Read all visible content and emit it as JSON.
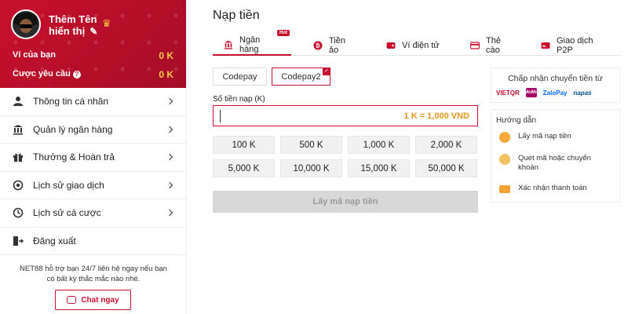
{
  "profile": {
    "name_line1": "Thêm Tên",
    "name_line2": "hiển thị",
    "wallet_label": "Ví của bạn",
    "wallet_value": "0 K",
    "bet_req_label": "Cược yêu cầu",
    "bet_req_value": "0 K"
  },
  "menu": [
    {
      "label": "Thông tin cá nhân",
      "icon": "user-icon"
    },
    {
      "label": "Quản lý ngân hàng",
      "icon": "bank-icon"
    },
    {
      "label": "Thưởng & Hoàn trả",
      "icon": "gift-icon"
    },
    {
      "label": "Lịch sử giao dịch",
      "icon": "history-icon"
    },
    {
      "label": "Lịch sử cá cược",
      "icon": "bet-history-icon"
    },
    {
      "label": "Đăng xuất",
      "icon": "logout-icon"
    }
  ],
  "support": {
    "text": "NET88 hỗ trợ bạn 24/7 liên hệ ngay nếu bạn có bất kỳ thắc mắc nào nhé.",
    "chat_label": "Chat ngay"
  },
  "page": {
    "title": "Nạp tiền"
  },
  "tabs": [
    {
      "label": "Ngân hàng",
      "badge": "Hot",
      "active": true
    },
    {
      "label": "Tiền ảo"
    },
    {
      "label": "Ví điện tử"
    },
    {
      "label": "Thẻ cào"
    },
    {
      "label": "Giao dịch P2P"
    }
  ],
  "subtabs": [
    {
      "label": "Codepay"
    },
    {
      "label": "Codepay2",
      "active": true
    }
  ],
  "amount": {
    "label": "Số tiền nạp (K)",
    "value": "",
    "rate": "1 K = 1,000 VND"
  },
  "quick_amounts": [
    "100 K",
    "500 K",
    "1,000 K",
    "2,000 K",
    "5,000 K",
    "10,000 K",
    "15,000 K",
    "50,000 K"
  ],
  "submit_label": "Lấy mã nạp tiền",
  "accept": {
    "title": "Chấp nhận chuyển tiền từ",
    "logos": [
      "VIETQR",
      "MoMo",
      "ZaloPay",
      "napas"
    ]
  },
  "guide": {
    "title": "Hướng dẫn",
    "steps": [
      "Lấy mã nạp tiền",
      "Quét mã hoặc chuyển khoản",
      "Xác nhận thanh toán"
    ]
  },
  "colors": {
    "brand": "#c8102e",
    "accent": "#e8961c"
  }
}
